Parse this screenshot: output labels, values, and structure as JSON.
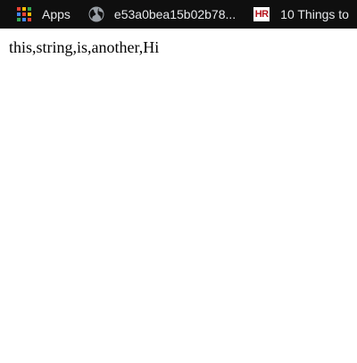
{
  "bookmarks_bar": {
    "apps_label": "Apps",
    "site_label": "e53a0bea15b02b78...",
    "hr_icon_text": "HR",
    "hr_label": "10 Things to"
  },
  "page": {
    "text": "this,string,is,another,Hi"
  },
  "colors": {
    "bar_background": "#0f0f0f",
    "bar_text": "#e8eaed",
    "hr_brand": "#b5121b",
    "page_background": "#ffffff",
    "page_text": "#000000"
  },
  "icons": {
    "apps": "apps-grid-icon",
    "site": "globe-icon",
    "hr": "hr-logo-icon"
  }
}
